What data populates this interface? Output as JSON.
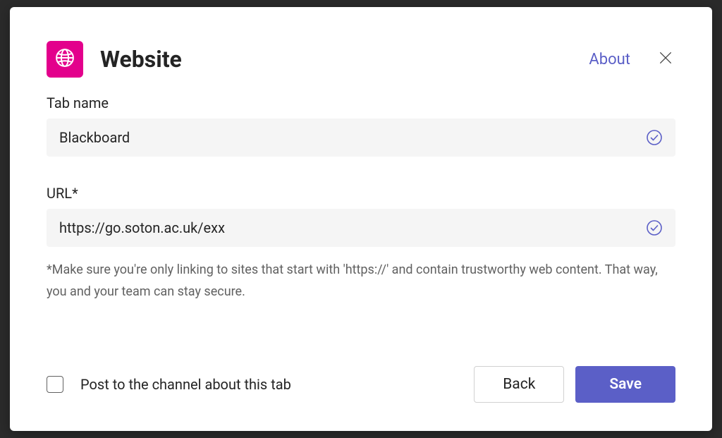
{
  "header": {
    "title": "Website",
    "about_label": "About"
  },
  "fields": {
    "tab_name": {
      "label": "Tab name",
      "value": "Blackboard"
    },
    "url": {
      "label": "URL*",
      "value": "https://go.soton.ac.uk/exx"
    }
  },
  "helper_text": "*Make sure you're only linking to sites that start with 'https://' and contain trustworthy web content. That way, you and your team can stay secure.",
  "post_checkbox": {
    "label": "Post to the channel about this tab",
    "checked": false
  },
  "buttons": {
    "back": "Back",
    "save": "Save"
  },
  "colors": {
    "brand_icon_bg": "#e3008c",
    "primary": "#5b5fc7"
  }
}
